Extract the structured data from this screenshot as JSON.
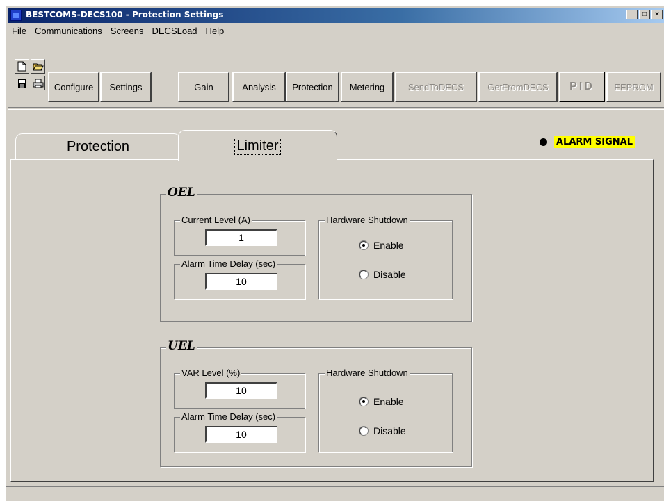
{
  "window": {
    "title": "BESTCOMS-DECS100 - Protection Settings",
    "controls": [
      "_",
      "□",
      "×"
    ]
  },
  "menu": [
    {
      "label": "File",
      "u": "F",
      "rest": "ile"
    },
    {
      "label": "Communications",
      "u": "C",
      "rest": "ommunications"
    },
    {
      "label": "Screens",
      "u": "S",
      "rest": "creens"
    },
    {
      "label": "DECSLoad",
      "u": "D",
      "rest": "ECSLoad"
    },
    {
      "label": "Help",
      "u": "H",
      "rest": "elp"
    }
  ],
  "toolbar": {
    "icons": [
      "new-file-icon",
      "open-folder-icon",
      "save-disk-icon",
      "printer-icon"
    ],
    "buttons": {
      "configure": "Configure",
      "settings": "Settings",
      "gain": "Gain",
      "analysis": "Analysis",
      "protection": "Protection",
      "metering": "Metering",
      "send": "SendToDECS",
      "get": "GetFromDECS",
      "pid": "PID",
      "eeprom": "EEPROM"
    }
  },
  "tabs": {
    "protection": "Protection",
    "limiter": "Limiter",
    "active": "Limiter"
  },
  "alarm": {
    "label": "ALARM SIGNAL",
    "highlight_color": "#ffff00"
  },
  "oel": {
    "title": "OEL",
    "current_level_label": "Current Level (A)",
    "current_level_value": "1",
    "alarm_delay_label": "Alarm Time Delay (sec)",
    "alarm_delay_value": "10",
    "hw_shutdown_label": "Hardware Shutdown",
    "enable_label": "Enable",
    "disable_label": "Disable",
    "selected": "Enable"
  },
  "uel": {
    "title": "UEL",
    "var_level_label": "VAR Level (%)",
    "var_level_value": "10",
    "alarm_delay_label": "Alarm Time Delay (sec)",
    "alarm_delay_value": "10",
    "hw_shutdown_label": "Hardware Shutdown",
    "enable_label": "Enable",
    "disable_label": "Disable",
    "selected": "Enable"
  }
}
